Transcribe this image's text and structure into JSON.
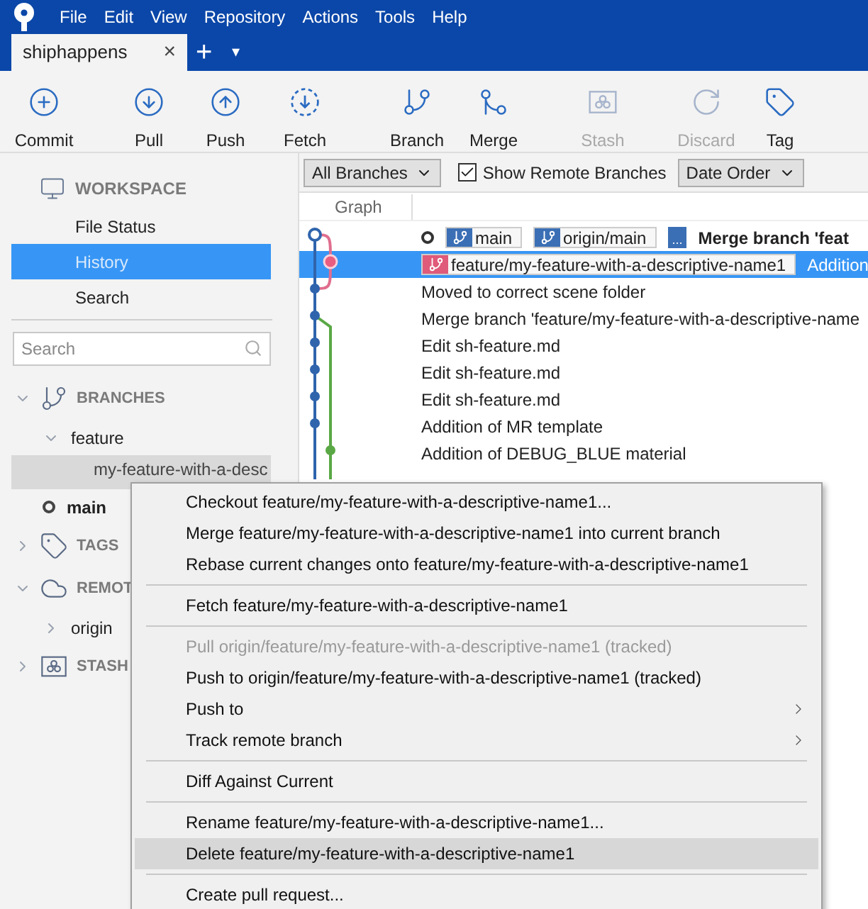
{
  "menu_bar": [
    "File",
    "Edit",
    "View",
    "Repository",
    "Actions",
    "Tools",
    "Help"
  ],
  "tabs": [
    {
      "label": "shiphappens",
      "selected": true,
      "close": "×"
    }
  ],
  "tab_actions": {
    "add": "+",
    "dropdown": "▾"
  },
  "toolbar": [
    {
      "label": "Commit",
      "disabled": false
    },
    {
      "label": "Pull",
      "disabled": false
    },
    {
      "label": "Push",
      "disabled": false
    },
    {
      "label": "Fetch",
      "disabled": false
    },
    {
      "label": "Branch",
      "disabled": false
    },
    {
      "label": "Merge",
      "disabled": false
    },
    {
      "label": "Stash",
      "disabled": true
    },
    {
      "label": "Discard",
      "disabled": true
    },
    {
      "label": "Tag",
      "disabled": false
    }
  ],
  "sidebar": {
    "workspace": {
      "title": "WORKSPACE",
      "items": [
        {
          "label": "File Status",
          "selected": false
        },
        {
          "label": "History",
          "selected": true
        },
        {
          "label": "Search",
          "selected": false
        }
      ]
    },
    "search": {
      "placeholder": "Search"
    },
    "sections": [
      {
        "title": "BRANCHES",
        "expanded": true,
        "children": [
          {
            "label": "feature",
            "expanded": true,
            "children": [
              {
                "label": "my-feature-with-a-desc",
                "selected": true
              }
            ]
          },
          {
            "label": "main",
            "current": true
          }
        ]
      },
      {
        "title": "TAGS",
        "expanded": false
      },
      {
        "title": "REMOT",
        "expanded": true,
        "children": [
          {
            "label": "origin",
            "expanded": false
          }
        ]
      },
      {
        "title": "STASH",
        "expanded": false
      }
    ]
  },
  "filters": {
    "branches": "All Branches",
    "show_remote": {
      "label": "Show Remote Branches",
      "checked": true
    },
    "order": "Date Order"
  },
  "graph_header": "Graph",
  "commits": [
    {
      "head": true,
      "refs": [
        {
          "label": "main",
          "color": "#3b6fb5"
        },
        {
          "label": "origin/main",
          "color": "#3b6fb5"
        },
        {
          "label": "...",
          "color": "#3b6fb5",
          "kind": "more"
        }
      ],
      "message": "Merge branch 'feat",
      "bold": true,
      "selected": false
    },
    {
      "head": false,
      "refs": [
        {
          "label": "feature/my-feature-with-a-descriptive-name1",
          "color": "#e05a7a"
        }
      ],
      "message": "Addition",
      "bold": false,
      "selected": true
    },
    {
      "head": false,
      "message": "Moved to correct scene folder",
      "bold": false,
      "selected": false
    },
    {
      "head": false,
      "message": "Merge branch 'feature/my-feature-with-a-descriptive-name",
      "bold": false,
      "selected": false
    },
    {
      "head": false,
      "message": "Edit sh-feature.md",
      "bold": false,
      "selected": false
    },
    {
      "head": false,
      "message": "Edit sh-feature.md",
      "bold": false,
      "selected": false
    },
    {
      "head": false,
      "message": "Edit sh-feature.md",
      "bold": false,
      "selected": false
    },
    {
      "head": false,
      "message": "Addition of MR template",
      "bold": false,
      "selected": false
    },
    {
      "head": false,
      "message": "Addition of DEBUG_BLUE material",
      "bold": false,
      "selected": false
    }
  ],
  "context_menu": [
    {
      "kind": "item",
      "label": "Checkout feature/my-feature-with-a-descriptive-name1...",
      "disabled": false,
      "submenu": false,
      "selected": false
    },
    {
      "kind": "item",
      "label": "Merge feature/my-feature-with-a-descriptive-name1 into current branch",
      "disabled": false,
      "submenu": false,
      "selected": false
    },
    {
      "kind": "item",
      "label": "Rebase current changes onto feature/my-feature-with-a-descriptive-name1",
      "disabled": false,
      "submenu": false,
      "selected": false
    },
    {
      "kind": "separator"
    },
    {
      "kind": "item",
      "label": "Fetch feature/my-feature-with-a-descriptive-name1",
      "disabled": false,
      "submenu": false,
      "selected": false
    },
    {
      "kind": "separator"
    },
    {
      "kind": "item",
      "label": "Pull origin/feature/my-feature-with-a-descriptive-name1 (tracked)",
      "disabled": true,
      "submenu": false,
      "selected": false
    },
    {
      "kind": "item",
      "label": "Push to origin/feature/my-feature-with-a-descriptive-name1 (tracked)",
      "disabled": false,
      "submenu": false,
      "selected": false
    },
    {
      "kind": "item",
      "label": "Push to",
      "disabled": false,
      "submenu": true,
      "selected": false
    },
    {
      "kind": "item",
      "label": "Track remote branch",
      "disabled": false,
      "submenu": true,
      "selected": false
    },
    {
      "kind": "separator"
    },
    {
      "kind": "item",
      "label": "Diff Against Current",
      "disabled": false,
      "submenu": false,
      "selected": false
    },
    {
      "kind": "separator"
    },
    {
      "kind": "item",
      "label": "Rename feature/my-feature-with-a-descriptive-name1...",
      "disabled": false,
      "submenu": false,
      "selected": false
    },
    {
      "kind": "item",
      "label": "Delete feature/my-feature-with-a-descriptive-name1",
      "disabled": false,
      "submenu": false,
      "selected": true
    },
    {
      "kind": "separator"
    },
    {
      "kind": "item",
      "label": "Create pull request...",
      "disabled": false,
      "submenu": false,
      "selected": false
    }
  ]
}
